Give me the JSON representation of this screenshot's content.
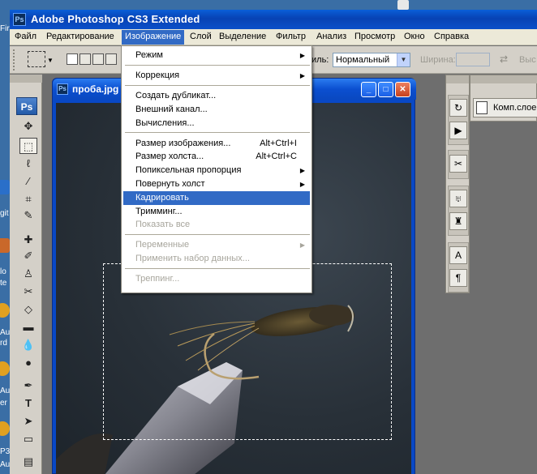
{
  "window": {
    "app_icon": "Ps",
    "title": "Adobe Photoshop CS3 Extended"
  },
  "menubar": {
    "items": [
      "Файл",
      "Редактирование",
      "Изображение",
      "Слой",
      "Выделение",
      "Фильтр",
      "Анализ",
      "Просмотр",
      "Окно",
      "Справка"
    ],
    "active_index": 2
  },
  "options_bar": {
    "style_label": "иль:",
    "style_value": "Нормальный",
    "width_label": "Ширина:",
    "height_label": "Выс"
  },
  "tools": {
    "logo": "Ps"
  },
  "document": {
    "icon": "Ps",
    "name": "проба.jpg"
  },
  "image_menu": {
    "items": [
      {
        "label": "Режим",
        "submenu": true,
        "disabled": false
      },
      {
        "separator": true
      },
      {
        "label": "Коррекция",
        "submenu": true,
        "disabled": false
      },
      {
        "separator": true
      },
      {
        "label": "Создать дубликат...",
        "disabled": false
      },
      {
        "label": "Внешний канал...",
        "disabled": false
      },
      {
        "label": "Вычисления...",
        "disabled": false
      },
      {
        "separator": true
      },
      {
        "label": "Размер изображения...",
        "shortcut": "Alt+Ctrl+I",
        "disabled": false
      },
      {
        "label": "Размер холста...",
        "shortcut": "Alt+Ctrl+C",
        "disabled": false
      },
      {
        "label": "Попиксельная пропорция",
        "submenu": true,
        "disabled": false
      },
      {
        "label": "Повернуть холст",
        "submenu": true,
        "disabled": false
      },
      {
        "label": "Кадрировать",
        "disabled": false,
        "highlighted": true
      },
      {
        "label": "Тримминг...",
        "disabled": false
      },
      {
        "label": "Показать все",
        "disabled": true
      },
      {
        "separator": true
      },
      {
        "label": "Переменные",
        "submenu": true,
        "disabled": true
      },
      {
        "label": "Применить набор данных...",
        "disabled": true
      },
      {
        "separator": true
      },
      {
        "label": "Треппинг...",
        "disabled": true
      }
    ]
  },
  "right_panel": {
    "layer_comps_label": "Комп.слое"
  },
  "desktop": {
    "labels": [
      "Fir",
      "git",
      "lo",
      "te",
      "Au",
      "rd",
      "Au",
      "er",
      "P3",
      "Au"
    ]
  }
}
